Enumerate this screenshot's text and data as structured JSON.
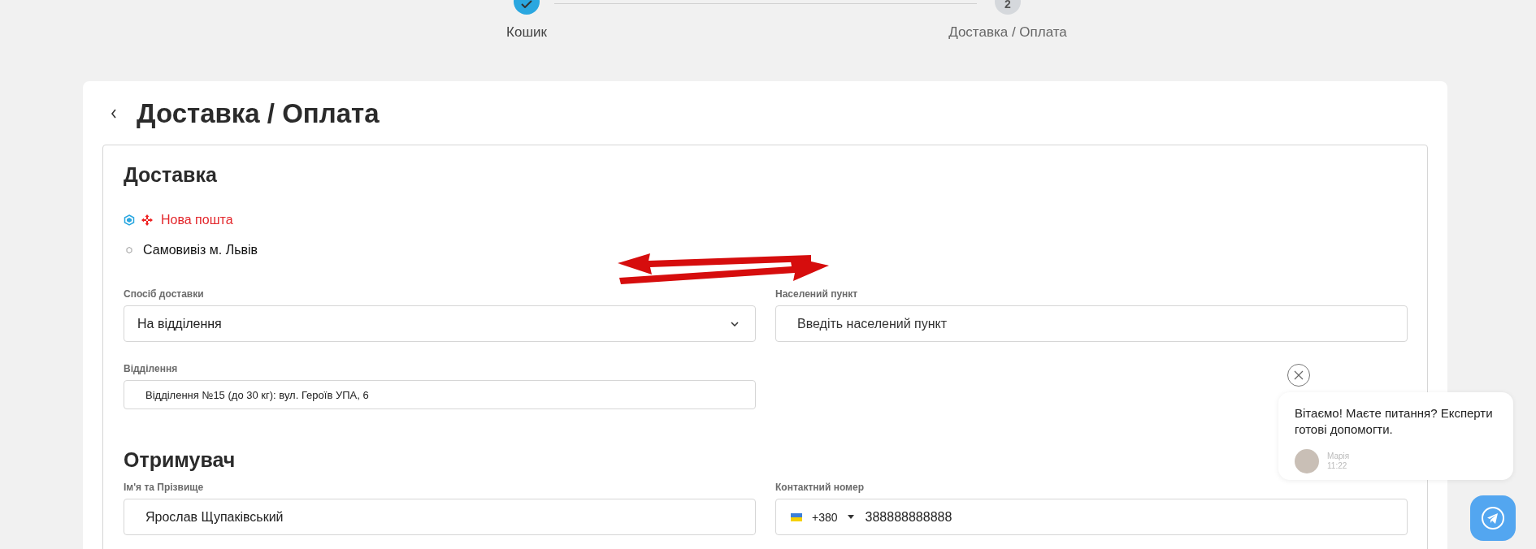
{
  "stepper": [
    {
      "label": "Кошик",
      "done": true
    },
    {
      "label": "Доставка / Оплата",
      "number": "2",
      "done": false
    }
  ],
  "page": {
    "title": "Доставка / Оплата"
  },
  "delivery": {
    "heading": "Доставка",
    "options": [
      {
        "label": "Нова пошта",
        "selected": true,
        "kind": "carrier"
      },
      {
        "label": "Самовивіз м. Львів",
        "selected": false,
        "kind": "pickup"
      }
    ],
    "fields": [
      {
        "label": "Спосіб доставки",
        "value": "На відділення",
        "kind": "select"
      },
      {
        "label": "Населений пункт",
        "placeholder": "Введіть населений пункт",
        "kind": "text"
      },
      {
        "label": "Відділення",
        "value": "Відділення №15 (до 30 кг): вул. Героїв УПА, 6",
        "kind": "small"
      }
    ]
  },
  "recipient": {
    "heading": "Отримувач",
    "fields": [
      {
        "label": "Ім'я та Прізвище",
        "value": "Ярослав Щупаківський",
        "kind": "text"
      },
      {
        "label": "Контактний номер",
        "code": "+380",
        "value": "388888888888",
        "kind": "phone"
      }
    ]
  },
  "chat": {
    "message": "Вітаємо! Маєте питання? Експерти готові допомогти.",
    "agent": "Марія",
    "time": "11:22"
  }
}
